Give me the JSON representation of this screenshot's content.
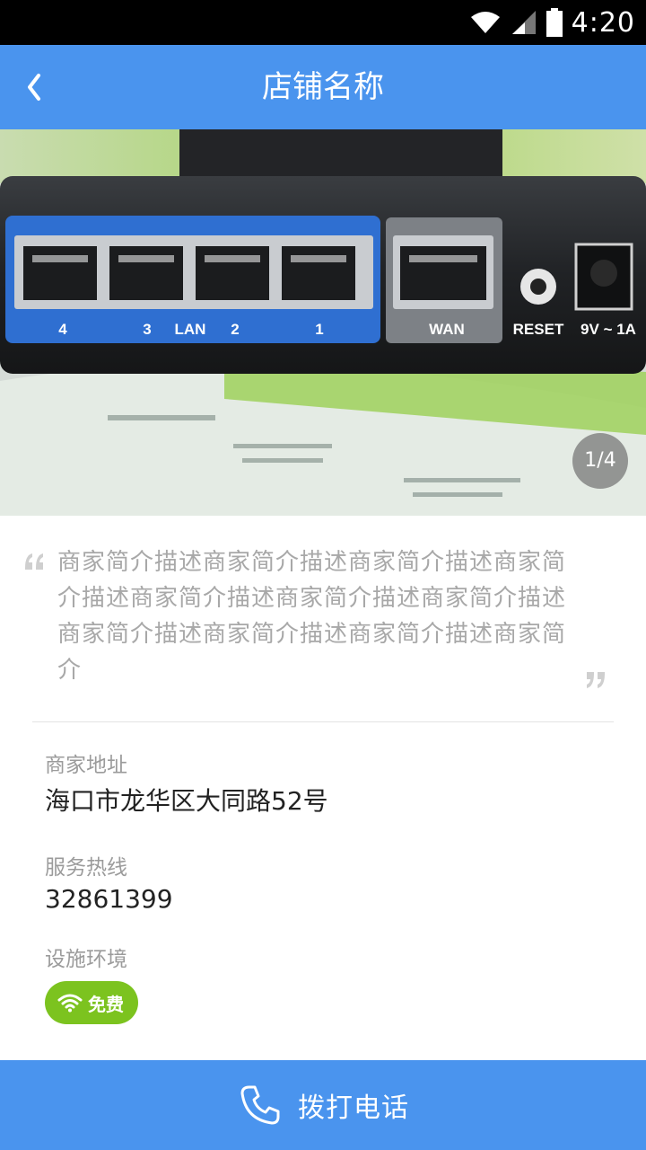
{
  "status_bar": {
    "time": "4:20",
    "icons": [
      "wifi-icon",
      "signal-icon",
      "battery-icon"
    ]
  },
  "nav": {
    "title": "店铺名称",
    "back_icon": "chevron-left-icon"
  },
  "banner": {
    "indicator": "1/4",
    "port_labels": [
      "4",
      "3",
      "LAN",
      "2",
      "1",
      "WAN",
      "RESET",
      "9V ~ 1A"
    ]
  },
  "description": "商家简介描述商家简介描述商家简介描述商家简介描述商家简介描述商家简介描述商家简介描述商家简介描述商家简介描述商家简介描述商家简介",
  "info": {
    "address_label": "商家地址",
    "address": "海口市龙华区大同路52号",
    "phone_label": "服务热线",
    "phone": "32861399",
    "facilities_label": "设施环境",
    "wifi_badge": "免费"
  },
  "call_bar": {
    "label": "拨打电话",
    "icon": "phone-icon"
  },
  "colors": {
    "primary": "#4a94ee",
    "wifi_badge": "#7cc31f",
    "status_bar": "#000000"
  }
}
